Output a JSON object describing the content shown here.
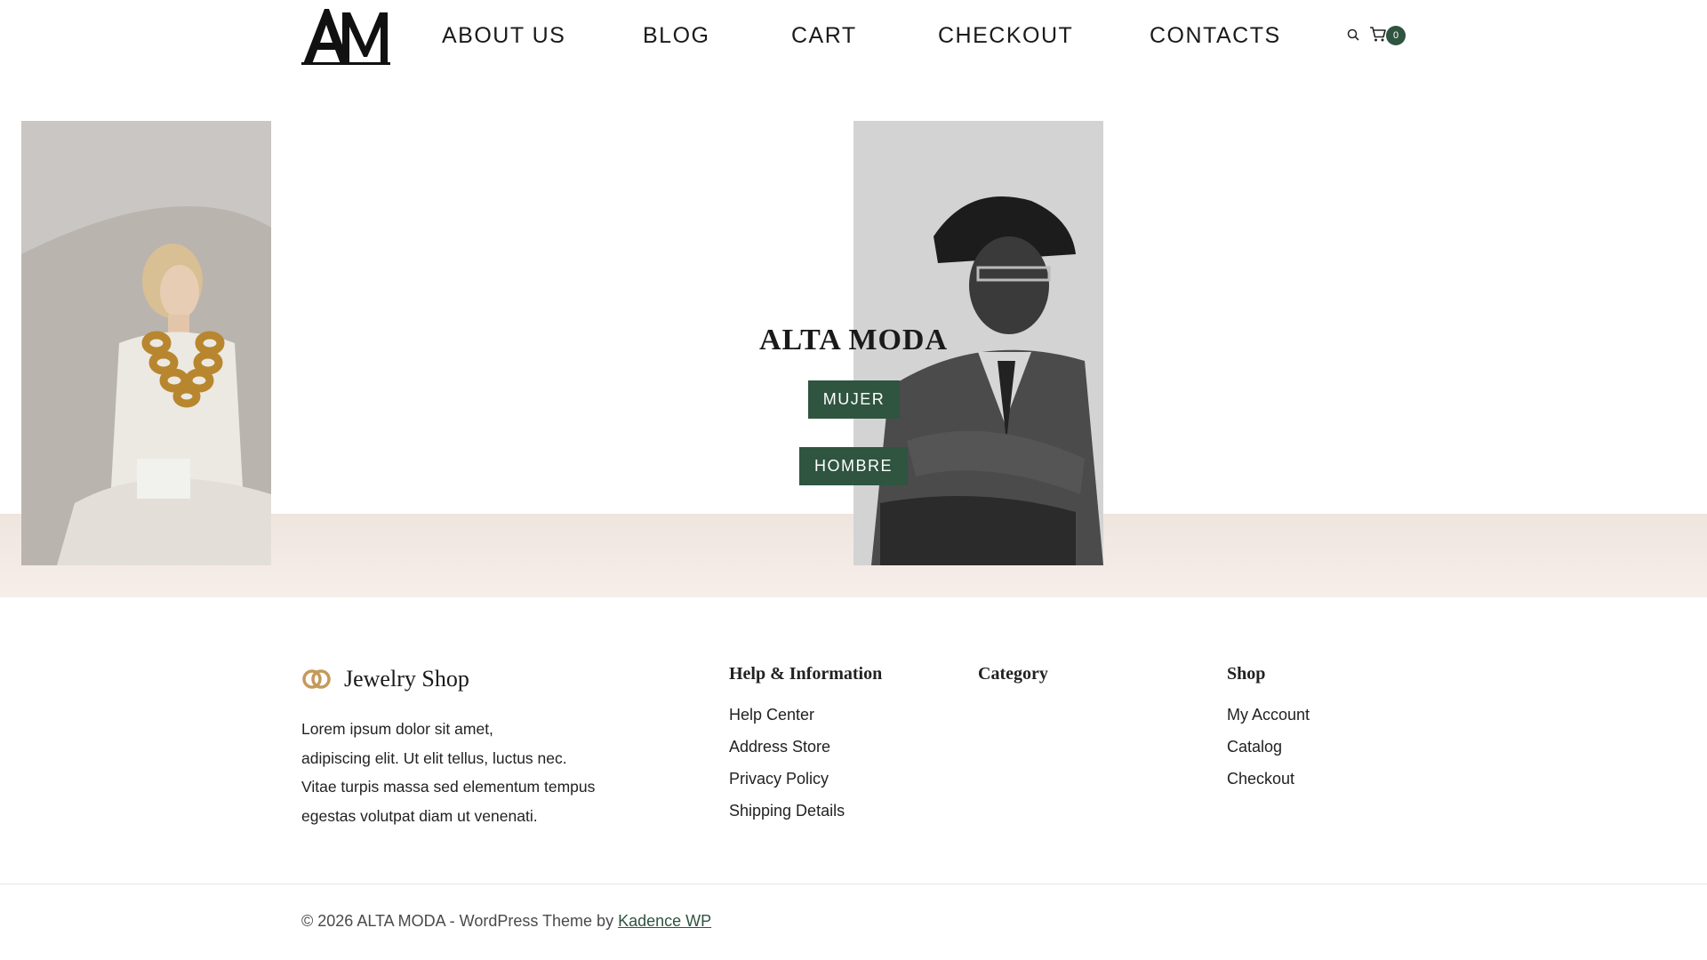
{
  "header": {
    "logo_text": "AM",
    "nav": {
      "about": "ABOUT US",
      "blog": "BLOG",
      "cart": "CART",
      "checkout": "CHECKOUT",
      "contacts": "CONTACTS"
    },
    "search_icon": "search-icon",
    "cart_icon": "shopping-cart-icon",
    "cart_count": "0"
  },
  "hero": {
    "title": "ALTA MODA",
    "buttons": {
      "mujer": "MUJER",
      "hombre": "HOMBRE"
    }
  },
  "footer": {
    "brand_name": "Jewelry Shop",
    "brand_icon": "rings-icon",
    "about_lines": [
      "Lorem ipsum dolor sit amet,",
      "adipiscing elit. Ut elit tellus, luctus nec.",
      "Vitae turpis massa sed elementum tempus",
      "egestas volutpat diam ut venenati."
    ],
    "columns": [
      {
        "title": "Help & Information",
        "links": [
          "Help Center",
          "Address Store",
          "Privacy Policy",
          "Shipping Details"
        ]
      },
      {
        "title": "Category",
        "links": []
      },
      {
        "title": "Shop",
        "links": [
          "My Account",
          "Catalog",
          "Checkout"
        ]
      }
    ],
    "copyright_text": "© 2026 ALTA MODA - WordPress Theme by ",
    "copyright_link": "Kadence WP"
  },
  "colors": {
    "accent": "#2f5440",
    "band": "#f3ebe6",
    "brand_gold": "#c49a5a"
  }
}
